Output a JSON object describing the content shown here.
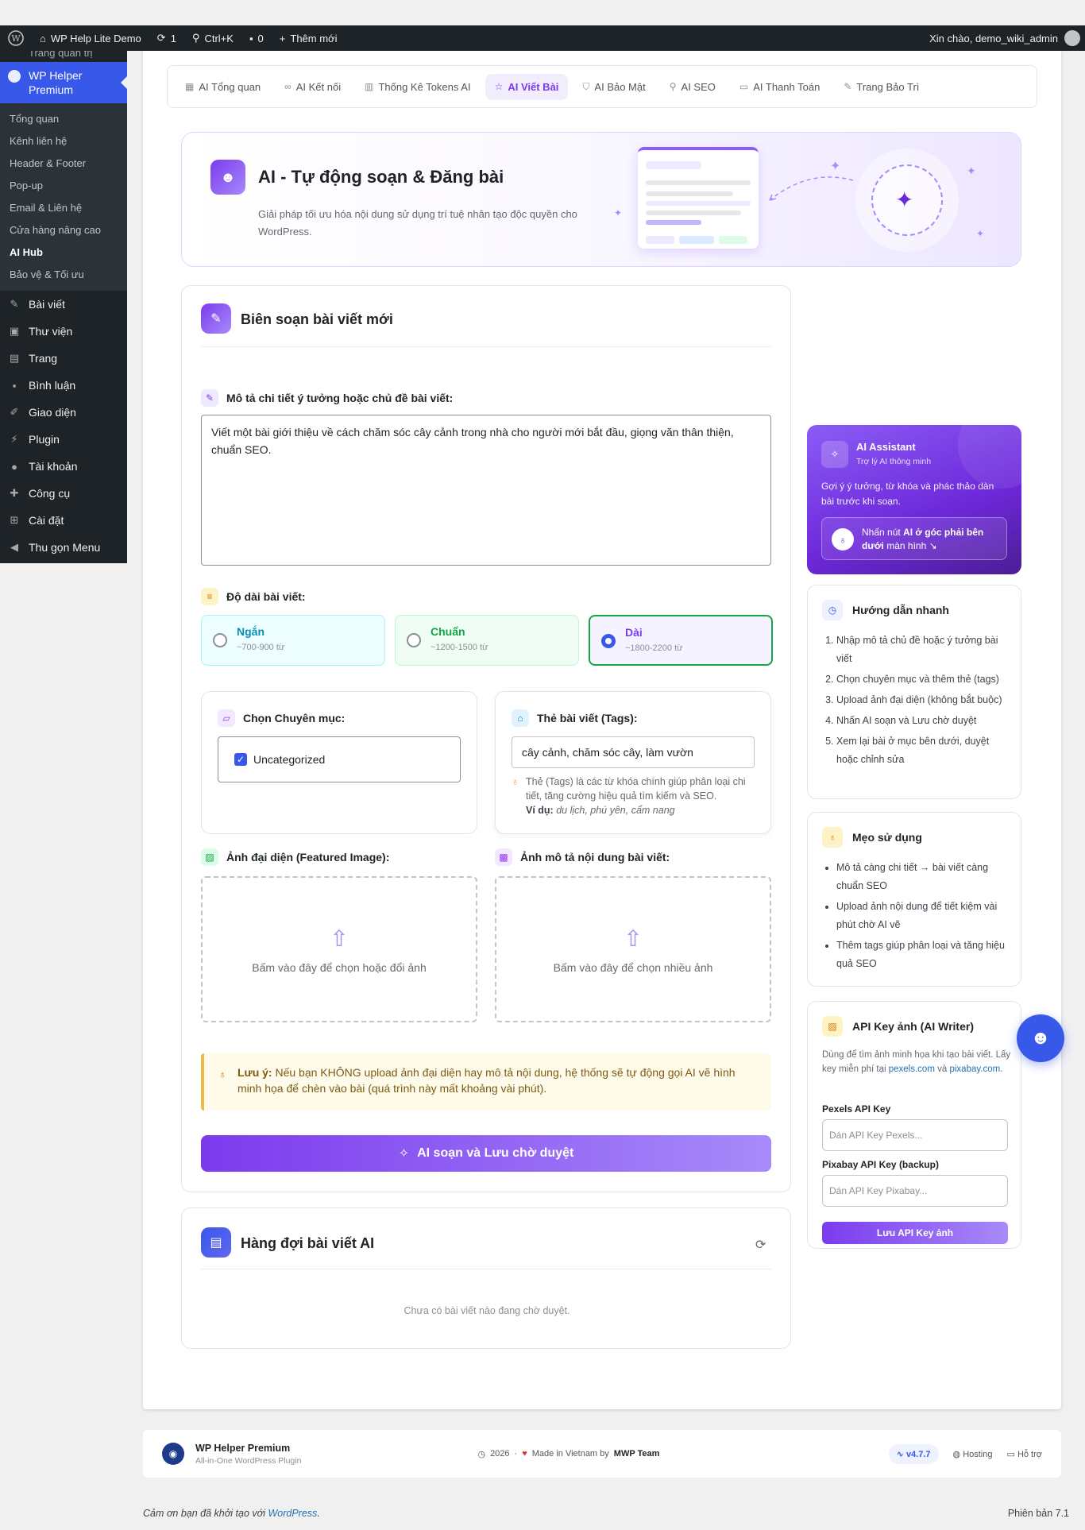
{
  "adminbar": {
    "site_name": "WP Help Lite Demo",
    "updates": "1",
    "shortcut": "Ctrl+K",
    "comments": "0",
    "new_label": "Thêm mới",
    "greeting": "Xin chào, demo_wiki_admin"
  },
  "sidebar": {
    "top_cut": "Trang quản trị",
    "active": "WP Helper Premium",
    "submenu": [
      "Tổng quan",
      "Kênh liên hệ",
      "Header & Footer",
      "Pop-up",
      "Email & Liên hệ",
      "Cửa hàng nâng cao",
      "AI Hub",
      "Bảo vệ & Tối ưu"
    ],
    "menu": [
      {
        "label": "Bài viết",
        "icon": "pin-icon"
      },
      {
        "label": "Thư viện",
        "icon": "media-icon"
      },
      {
        "label": "Trang",
        "icon": "page-icon"
      },
      {
        "label": "Bình luận",
        "icon": "comment-icon"
      },
      {
        "label": "Giao diện",
        "icon": "brush-icon"
      },
      {
        "label": "Plugin",
        "icon": "plug-icon"
      },
      {
        "label": "Tài khoản",
        "icon": "user-icon"
      },
      {
        "label": "Công cụ",
        "icon": "wrench-icon"
      },
      {
        "label": "Cài đặt",
        "icon": "settings-icon"
      },
      {
        "label": "Thu gọn Menu",
        "icon": "collapse-icon"
      }
    ]
  },
  "tabs": [
    "AI Tổng quan",
    "AI Kết nối",
    "Thống Kê Tokens AI",
    "AI Viết Bài",
    "AI Bảo Mật",
    "AI SEO",
    "AI Thanh Toán",
    "Trang Bảo Trì"
  ],
  "hero": {
    "title": "AI - Tự động soạn & Đăng bài",
    "subtitle": "Giải pháp tối ưu hóa nội dung sử dụng trí tuệ nhân tạo độc quyền cho WordPress."
  },
  "composer": {
    "title": "Biên soạn bài viết mới",
    "desc_label": "Mô tả chi tiết ý tưởng hoặc chủ đề bài viết:",
    "desc_value": "Viết một bài giới thiệu về cách chăm sóc cây cảnh trong nhà cho người mới bắt đầu, giọng văn thân thiện, chuẩn SEO.",
    "length_label": "Độ dài bài viết:",
    "lengths": [
      {
        "name": "Ngắn",
        "hint": "~700-900 từ"
      },
      {
        "name": "Chuẩn",
        "hint": "~1200-1500 từ"
      },
      {
        "name": "Dài",
        "hint": "~1800-2200 từ"
      }
    ],
    "selected_length": "Dài",
    "category_label": "Chọn Chuyên mục:",
    "category_value": "Uncategorized",
    "tags_label": "Thẻ bài viết (Tags):",
    "tags_value": "cây cảnh, chăm sóc cây, làm vườn",
    "tags_help": "Thẻ (Tags) là các từ khóa chính giúp phân loại chi tiết, tăng cường hiệu quả tìm kiếm và SEO.",
    "tags_example_label": "Ví dụ:",
    "tags_example": "du lịch, phú yên, cẩm nang",
    "featured_label": "Ảnh đại diện (Featured Image):",
    "featured_hint": "Bấm vào đây để chọn hoặc đổi ảnh",
    "content_img_label": "Ảnh mô tả nội dung bài viết:",
    "content_img_hint": "Bấm vào đây để chọn nhiều ảnh",
    "note_label": "Lưu ý:",
    "note_text": "Nếu bạn KHÔNG upload ảnh đại diện hay mô tả nội dung, hệ thống sẽ tự động gọi AI vẽ hình minh họa để chèn vào bài (quá trình này mất khoảng vài phút).",
    "submit": "AI soạn và Lưu chờ duyệt"
  },
  "queue": {
    "title": "Hàng đợi bài viết AI",
    "empty": "Chưa có bài viết nào đang chờ duyệt."
  },
  "assistant": {
    "title": "AI Assistant",
    "subtitle": "Trợ lý AI thông minh",
    "desc": "Gợi ý ý tưởng, từ khóa và phác thảo dàn bài trước khi soạn.",
    "tip_pre": "Nhấn nút",
    "tip_bold": "AI ở góc phải bên dưới",
    "tip_post": "màn hình ↘"
  },
  "guide": {
    "title": "Hướng dẫn nhanh",
    "steps": [
      "Nhập mô tả chủ đề hoặc ý tưởng bài viết",
      "Chọn chuyên mục và thêm thẻ (tags)",
      "Upload ảnh đại diện (không bắt buộc)",
      "Nhấn AI soạn và Lưu chờ duyệt",
      "Xem lại bài ở mục bên dưới, duyệt hoặc chỉnh sửa"
    ]
  },
  "tips": {
    "title": "Mẹo sử dụng",
    "items": [
      "Mô tả càng chi tiết → bài viết càng chuẩn SEO",
      "Upload ảnh nội dung để tiết kiệm vài phút chờ AI vẽ",
      "Thêm tags giúp phân loại và tăng hiệu quả SEO"
    ]
  },
  "api": {
    "title": "API Key ảnh (AI Writer)",
    "desc": "Dùng để tìm ảnh minh họa khi tạo bài viết. Lấy key miễn phí tại",
    "link1": "pexels.com",
    "and": "và",
    "link2": "pixabay.com",
    "pexels_label": "Pexels API Key",
    "pexels_placeholder": "Dán API Key Pexels...",
    "pixabay_label": "Pixabay API Key (backup)",
    "pixabay_placeholder": "Dán API Key Pixabay...",
    "save": "Lưu API Key ảnh"
  },
  "footer": {
    "name": "WP Helper Premium",
    "tagline": "All-in-One WordPress Plugin",
    "year": "2026",
    "made": "Made in Vietnam by",
    "team": "MWP Team",
    "version": "v4.7.7",
    "hosting": "Hosting",
    "support": "Hỗ trợ"
  },
  "bottom": {
    "thanks": "Cảm ơn bạn đã khởi tạo với",
    "wp": "WordPress",
    "version": "Phiên bản 7.1"
  },
  "colors": {
    "accent": "#7c3aed",
    "admin_blue": "#3858e9",
    "adminbar": "#1d2327"
  }
}
